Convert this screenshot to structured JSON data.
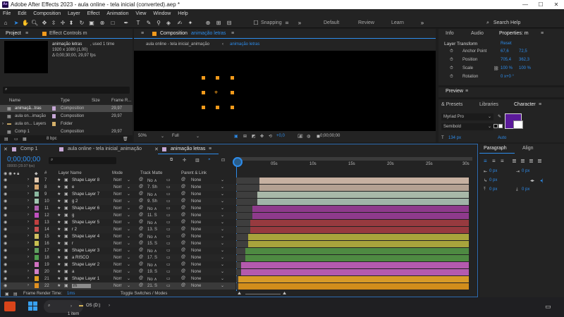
{
  "window": {
    "title": "Adobe After Effects 2023 - aula online - tela inicial (converted).aep *",
    "app_badge": "Ae"
  },
  "menu": [
    "File",
    "Edit",
    "Composition",
    "Layer",
    "Effect",
    "Animation",
    "View",
    "Window",
    "Help"
  ],
  "toolbar": {
    "snapping": "Snapping",
    "workspaces": [
      "Default",
      "Review",
      "Learn"
    ],
    "search_placeholder": "Search Help"
  },
  "project_panel": {
    "tab_project": "Project",
    "tab_effect_controls": "Effect Controls m",
    "selected_name": "animação letras",
    "selected_used": ", used 1 time",
    "selected_res": "1920 x 1080 (1,00)",
    "selected_dur": "Δ 0;00;30;00, 29,97 fps",
    "columns": [
      "Name",
      "Type",
      "Size",
      "Frame R..."
    ],
    "items": [
      {
        "name": "animaçã...tras",
        "type": "Composition",
        "fr": "29,97"
      },
      {
        "name": "aula on...imação",
        "type": "Composition",
        "fr": "29,97"
      },
      {
        "name": "aula on... Layers",
        "type": "Folder",
        "fr": ""
      },
      {
        "name": "Comp 1",
        "type": "Composition",
        "fr": "29,97"
      }
    ],
    "bpc": "8 bpc"
  },
  "composition_panel": {
    "label": "Composition",
    "comp_name": "animação letras",
    "breadcrumb_1": "aula online - tela inicial_animação",
    "breadcrumb_2": "animação letras",
    "zoom": "50%",
    "quality": "Full",
    "exposure": "+0,0",
    "timecode": "0;00;00;00"
  },
  "right_panel": {
    "tabs": [
      "Info",
      "Audio",
      "Properties: m"
    ],
    "layer_transform": "Layer Transform",
    "reset": "Reset",
    "props": [
      {
        "name": "Anchor Point",
        "v1": "67,6",
        "v2": "72,5"
      },
      {
        "name": "Position",
        "v1": "705,4",
        "v2": "362,3"
      },
      {
        "name": "Scale",
        "v1": "100 %",
        "v2": "100 %"
      },
      {
        "name": "Rotation",
        "v1": "0 x+0 °",
        "v2": ""
      }
    ],
    "preview": "Preview",
    "presets": "& Presets",
    "libraries": "Libraries",
    "character": "Character",
    "font_family": "Myriad Pro",
    "font_style": "Semibold",
    "font_size": "134 px",
    "tracking": "Auto",
    "paragraph": "Paragraph",
    "align": "Align",
    "px_values": [
      "0 px",
      "0 px",
      "0 px",
      "0 px",
      "0 px"
    ]
  },
  "timeline": {
    "tabs": [
      "Comp 1",
      "aula online - tela inicial_animação",
      "animação letras"
    ],
    "timecode": "0;00;00;00",
    "time_sub": "00000 (29.97 fps)",
    "col_headers": {
      "layer_name": "Layer Name",
      "mode": "Mode",
      "track_matte": "Track Matte",
      "parent": "Parent & Link"
    },
    "ruler": [
      "0s",
      "05s",
      "10s",
      "15s",
      "20s",
      "25s",
      "30s"
    ],
    "layers": [
      {
        "num": "7",
        "name": "Shape Layer 8",
        "mode": "Norr",
        "matte": "No ∧",
        "parent": "None",
        "color": "#e0c8b0",
        "bar": "#c7b1a1",
        "start": 0.1
      },
      {
        "num": "8",
        "name": "e",
        "mode": "Norr",
        "matte": "7. Sh",
        "parent": "None",
        "color": "#d8a870",
        "bar": "#b4a192",
        "start": 0.1
      },
      {
        "num": "9",
        "name": "Shape Layer 7",
        "mode": "Norr",
        "matte": "No ∧",
        "parent": "None",
        "color": "#8ab8a0",
        "bar": "#a8b8a8",
        "start": 0.09
      },
      {
        "num": "10",
        "name": "g 2",
        "mode": "Norr",
        "matte": "9. Sh",
        "parent": "None",
        "color": "#a0c8b0",
        "bar": "#a0b4a8",
        "start": 0.09
      },
      {
        "num": "11",
        "name": "Shape Layer 6",
        "mode": "Norr",
        "matte": "No ∧",
        "parent": "None",
        "color": "#b060b0",
        "bar": "#8e3a8c",
        "start": 0.07
      },
      {
        "num": "12",
        "name": "g",
        "mode": "Norr",
        "matte": "11. S",
        "parent": "None",
        "color": "#c050c0",
        "bar": "#8e3a8c",
        "start": 0.07
      },
      {
        "num": "13",
        "name": "Shape Layer 5",
        "mode": "Norr",
        "matte": "No ∧",
        "parent": "None",
        "color": "#c04040",
        "bar": "#973a3f",
        "start": 0.06
      },
      {
        "num": "14",
        "name": "r 2",
        "mode": "Norr",
        "matte": "13. S",
        "parent": "None",
        "color": "#c85050",
        "bar": "#973a3f",
        "start": 0.06
      },
      {
        "num": "15",
        "name": "Shape Layer 4",
        "mode": "Norr",
        "matte": "No ∧",
        "parent": "None",
        "color": "#d0c060",
        "bar": "#a8a43c",
        "start": 0.05
      },
      {
        "num": "16",
        "name": "r",
        "mode": "Norr",
        "matte": "15. S",
        "parent": "None",
        "color": "#c8c050",
        "bar": "#a8a43c",
        "start": 0.05
      },
      {
        "num": "17",
        "name": "Shape Layer 3",
        "mode": "Norr",
        "matte": "No ∧",
        "parent": "None",
        "color": "#60a060",
        "bar": "#4e8a42",
        "start": 0.04
      },
      {
        "num": "18",
        "name": "a RISCO",
        "mode": "Norr",
        "matte": "17. S",
        "parent": "None",
        "color": "#50a050",
        "bar": "#4e8a42",
        "start": 0.04
      },
      {
        "num": "19",
        "name": "Shape Layer 2",
        "mode": "Norr",
        "matte": "No ∧",
        "parent": "None",
        "color": "#d070c0",
        "bar": "#b45aae",
        "start": 0.02
      },
      {
        "num": "20",
        "name": "a",
        "mode": "Norr",
        "matte": "19. S",
        "parent": "None",
        "color": "#d080c8",
        "bar": "#b45aae",
        "start": 0.02
      },
      {
        "num": "21",
        "name": "Shape Layer 1",
        "mode": "Norr",
        "matte": "No ∧",
        "parent": "None",
        "color": "#e0a020",
        "bar": "#d79a27",
        "start": 0.01
      },
      {
        "num": "22",
        "name": "m",
        "mode": "Norr",
        "matte": "21. S",
        "parent": "None",
        "color": "#e09020",
        "bar": "#d18d1b",
        "start": 0.01
      }
    ],
    "footer_render": "Frame Render Time:",
    "footer_render_val": "1ms",
    "footer_toggle": "Toggle Switches / Modes"
  },
  "taskbar": {
    "explorer_label": "OS (D:)",
    "status": "1 item"
  },
  "colors": {
    "accent": "#2d8ceb",
    "panel": "#232323",
    "bg": "#1d1d1d",
    "handle": "#f29a1b"
  }
}
